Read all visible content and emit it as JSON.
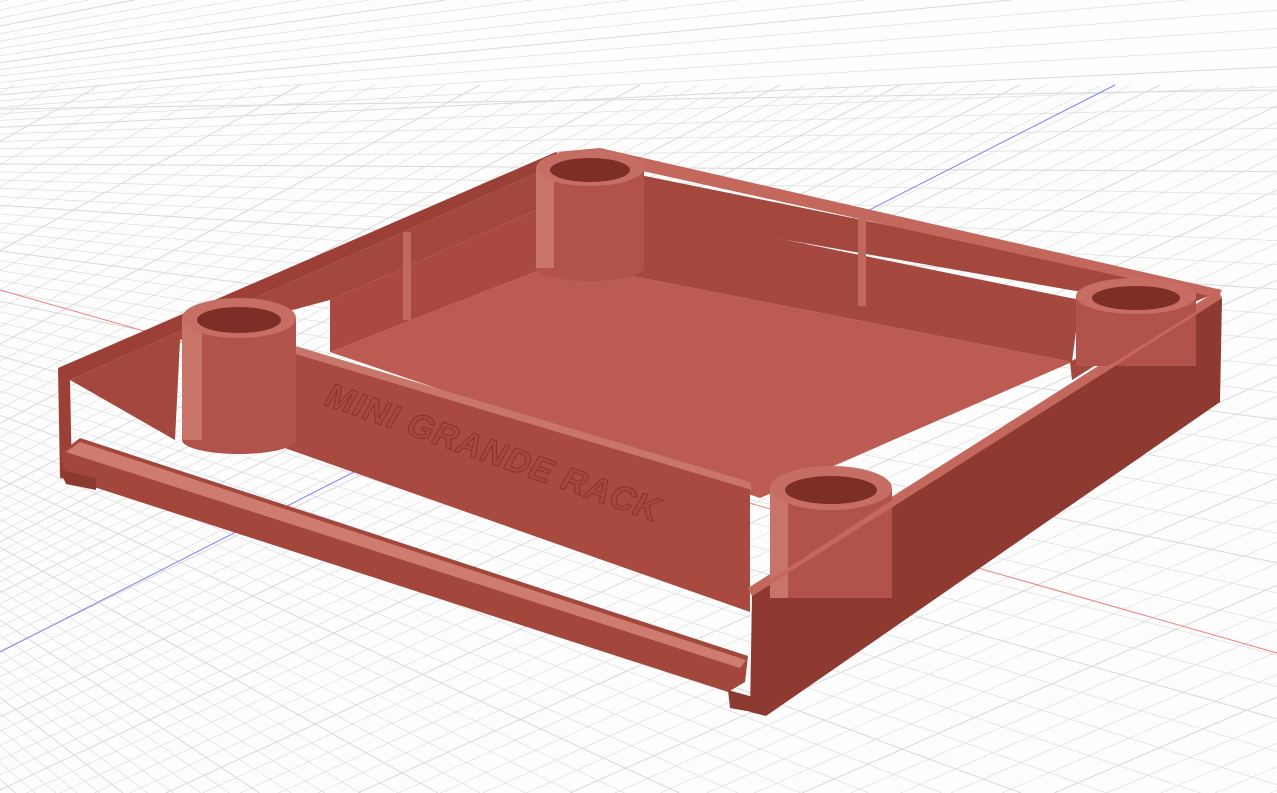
{
  "viewport": {
    "background": "#fdfdfd",
    "grid_color": "#d9d9d9",
    "x_axis_color": "#f08080",
    "y_axis_color": "#8080f0"
  },
  "model": {
    "name": "MINI GRANDE RACK",
    "embossed_text": "MINI GRANDE RACK",
    "color_main": "#b5544a",
    "color_dark": "#8c3930",
    "color_light": "#c4675c"
  }
}
